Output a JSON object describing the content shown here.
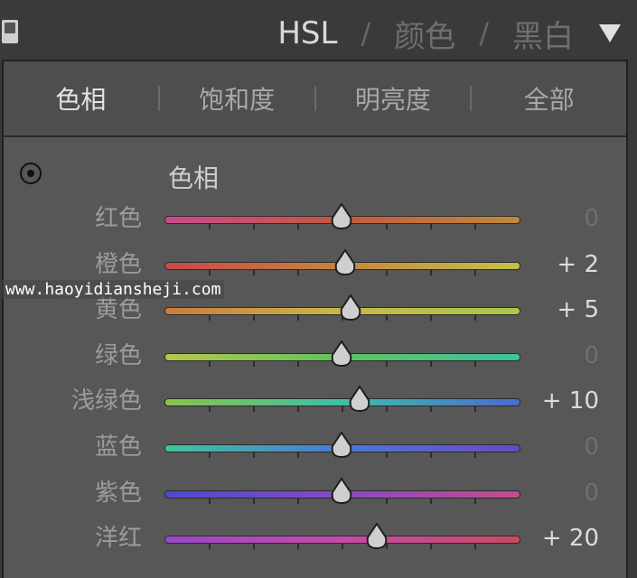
{
  "header": {
    "modes": [
      {
        "label": "HSL",
        "active": true
      },
      {
        "label": "颜色",
        "active": false
      },
      {
        "label": "黑白",
        "active": false
      }
    ],
    "separator": "/",
    "menu_icon": "triangle-down-icon"
  },
  "tabs": [
    {
      "label": "色相",
      "active": true
    },
    {
      "label": "饱和度",
      "active": false
    },
    {
      "label": "明亮度",
      "active": false
    },
    {
      "label": "全部",
      "active": false
    }
  ],
  "section": {
    "title": "色相",
    "target_icon": "target-adjustment-icon"
  },
  "sliders": [
    {
      "label": "红色",
      "value": "0",
      "numeric": 0,
      "gradient": [
        "#c64a8c",
        "#c45a3e",
        "#c08a3a"
      ]
    },
    {
      "label": "橙色",
      "value": "+ 2",
      "numeric": 2,
      "gradient": [
        "#c94848",
        "#c8863c",
        "#c2c24a"
      ]
    },
    {
      "label": "黄色",
      "value": "+ 5",
      "numeric": 5,
      "gradient": [
        "#cc7a3e",
        "#c9b848",
        "#a8c848"
      ]
    },
    {
      "label": "绿色",
      "value": "0",
      "numeric": 0,
      "gradient": [
        "#b6c84a",
        "#5ec45e",
        "#3ec2a2"
      ]
    },
    {
      "label": "浅绿色",
      "value": "+ 10",
      "numeric": 10,
      "gradient": [
        "#8ac44a",
        "#3ebfa6",
        "#4a6ad0"
      ]
    },
    {
      "label": "蓝色",
      "value": "0",
      "numeric": 0,
      "gradient": [
        "#3ec4a0",
        "#4a7ad4",
        "#6a48c4"
      ]
    },
    {
      "label": "紫色",
      "value": "0",
      "numeric": 0,
      "gradient": [
        "#4a4ad0",
        "#8a48c8",
        "#c64a8c"
      ]
    },
    {
      "label": "洋红",
      "value": "+ 20",
      "numeric": 20,
      "gradient": [
        "#9a48c8",
        "#c64aa8",
        "#c84a62"
      ]
    }
  ],
  "slider_range": [
    -100,
    100
  ],
  "watermark": "www.haoyidiansheji.com"
}
